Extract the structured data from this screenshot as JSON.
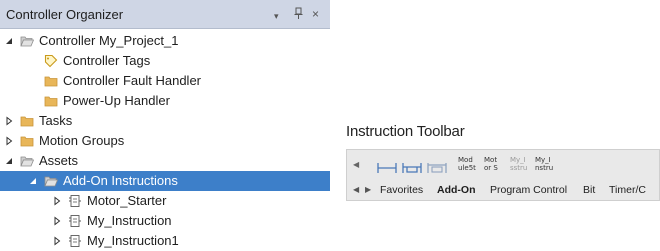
{
  "organizer": {
    "title": "Controller Organizer",
    "header_buttons": {
      "dropdown": "▾",
      "pin": "ᵖ",
      "close": "×"
    },
    "tree": [
      {
        "label": "Controller My_Project_1",
        "icon": "folder-open-icon",
        "expander": "expanded"
      },
      {
        "label": "Controller Tags",
        "icon": "tag-icon",
        "expander": "none"
      },
      {
        "label": "Controller Fault Handler",
        "icon": "folder-icon",
        "expander": "none"
      },
      {
        "label": "Power-Up Handler",
        "icon": "folder-icon",
        "expander": "none"
      },
      {
        "label": "Tasks",
        "icon": "folder-icon",
        "expander": "collapsed"
      },
      {
        "label": "Motion Groups",
        "icon": "folder-icon",
        "expander": "collapsed"
      },
      {
        "label": "Assets",
        "icon": "folder-open-icon",
        "expander": "expanded"
      },
      {
        "label": "Add-On Instructions",
        "icon": "folder-open-icon",
        "expander": "expanded",
        "selected": true
      },
      {
        "label": "Motor_Starter",
        "icon": "aoi-icon",
        "expander": "collapsed"
      },
      {
        "label": "My_Instruction",
        "icon": "aoi-icon",
        "expander": "collapsed"
      },
      {
        "label": "My_Instruction1",
        "icon": "aoi-icon",
        "expander": "collapsed"
      }
    ]
  },
  "toolbar": {
    "caption": "Instruction Toolbar",
    "buttons": [
      {
        "line1": "Mod",
        "line2": "ule5t"
      },
      {
        "line1": "Mot",
        "line2": "or S"
      },
      {
        "line1": "My_I",
        "line2": "sstru",
        "dim": true
      },
      {
        "line1": "My_I",
        "line2": "nstru"
      }
    ],
    "tabs": [
      "Favorites",
      "Add-On",
      "Program Control",
      "Bit",
      "Timer/C"
    ],
    "active_tab": "Add-On"
  },
  "colors": {
    "header_bg": "#cfd6e5",
    "selection": "#3d7fc9",
    "folder": "#e8b659",
    "toolbar_bg": "#e9e9e9"
  }
}
